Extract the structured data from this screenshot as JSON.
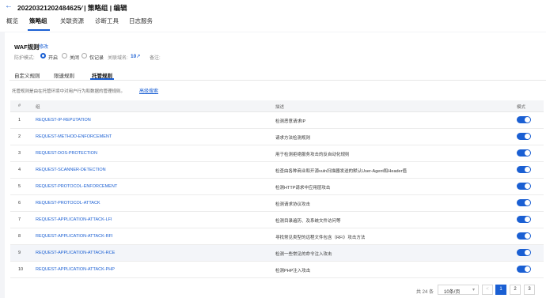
{
  "header": {
    "back_icon": "back-arrow-icon",
    "title": "20220321202484625⁄  | 策略组 | 编辑",
    "tabs": [
      {
        "label": "概览"
      },
      {
        "label": "策略组",
        "active": true
      },
      {
        "label": "关联资源"
      },
      {
        "label": "诊断工具"
      },
      {
        "label": "日志服务"
      }
    ]
  },
  "waf": {
    "title": "WAF规则",
    "edit": "修改",
    "mode_label": "防护模式:",
    "modes": [
      "开启",
      "关闭",
      "仅记录"
    ],
    "selected_mode": "开启",
    "domain_label": "关联域名:",
    "domain_count": "10",
    "link_icon": "link-icon",
    "note_label": "备注:"
  },
  "subtabs": [
    {
      "label": "自定义规则"
    },
    {
      "label": "限速规则"
    },
    {
      "label": "托管规则",
      "active": true
    }
  ],
  "managed": {
    "description": "托管规则是由在托管环境中对用户行为和数据的管理规则。",
    "advanced_search": "高级搜索",
    "columns": [
      "#",
      "组",
      "描述",
      "模式"
    ],
    "rows": [
      {
        "index": "1",
        "group": "REQUEST-IP-REPUTATION",
        "desc": "检测恶意请求IP",
        "enabled": true
      },
      {
        "index": "2",
        "group": "REQUEST-METHOD-ENFORCEMENT",
        "desc": "请求方法检测规则",
        "enabled": true
      },
      {
        "index": "3",
        "group": "REQUEST-DOS-PROTECTION",
        "desc": "用于检测拒绝服务攻击的反自动化规则",
        "enabled": true
      },
      {
        "index": "4",
        "group": "REQUEST-SCANNER-DETECTION",
        "desc": "检查由各种商业和开源vuln扫描器发送的默认User-Agent和Header值",
        "enabled": true
      },
      {
        "index": "5",
        "group": "REQUEST-PROTOCOL-ENFORCEMENT",
        "desc": "检测HTTP请求中应用层攻击",
        "enabled": true
      },
      {
        "index": "6",
        "group": "REQUEST-PROTOCOL-ATTACK",
        "desc": "检测请求协议攻击",
        "enabled": true
      },
      {
        "index": "7",
        "group": "REQUEST-APPLICATION-ATTACK-LFI",
        "desc": "检测目录遍历、及系统文件访问等",
        "enabled": true
      },
      {
        "index": "8",
        "group": "REQUEST-APPLICATION-ATTACK-RFI",
        "desc": "寻找常见类型的远程文件包含（RFI）攻击方法",
        "enabled": true
      },
      {
        "index": "9",
        "group": "REQUEST-APPLICATION-ATTACK-RCE",
        "desc": "检测一些常见的命令注入攻击",
        "enabled": true
      },
      {
        "index": "10",
        "group": "REQUEST-APPLICATION-ATTACK-PHP",
        "desc": "检测PHP注入攻击",
        "enabled": true
      }
    ]
  },
  "pagination": {
    "total": "共 24 条",
    "page_size": "10条/页",
    "prev": "<",
    "pages": [
      "1",
      "2",
      "3"
    ],
    "current": "1"
  },
  "colors": {
    "accent": "#1a5fd3",
    "link": "#1a5fd3"
  }
}
